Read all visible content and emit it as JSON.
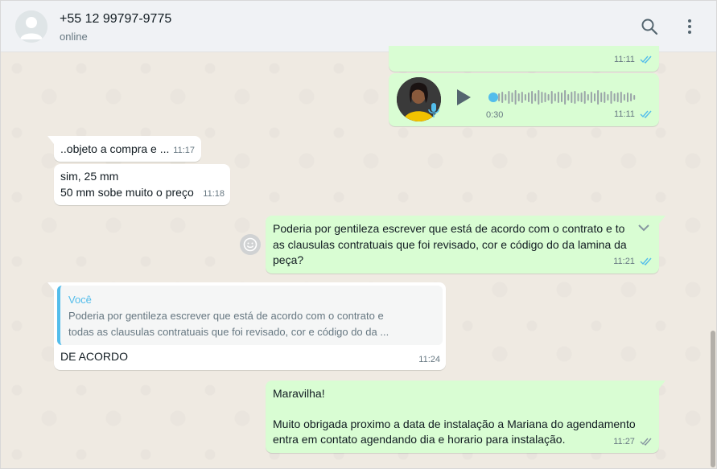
{
  "header": {
    "contact_name": "+55 12 99797-9775",
    "status": "online"
  },
  "messages": {
    "m1": {
      "time": "11:11"
    },
    "audio": {
      "duration": "0:30",
      "time": "11:11",
      "progress": 0.0
    },
    "m3": {
      "text": "..objeto a compra e ...",
      "time": "11:17"
    },
    "m4": {
      "line1": "sim, 25 mm",
      "line2": "50 mm sobe muito o preço",
      "time": "11:18"
    },
    "m5": {
      "line1": "Poderia por gentileza escrever que está de acordo com o contrato e to",
      "line2": "as clausulas contratuais que foi revisado, cor e código do da lamina da",
      "line3": "peça?",
      "time": "11:21"
    },
    "m6": {
      "quote_author": "Você",
      "quote_line1": "Poderia por gentileza escrever que está de acordo com o contrato e",
      "quote_line2": "todas as clausulas contratuais que foi revisado, cor e código do da ...",
      "text": "DE ACORDO",
      "time": "11:24"
    },
    "m7": {
      "line1": "Maravilha!",
      "line2": "Muito obrigada proximo a data de instalação a Mariana do agendamento",
      "line3": "entra em contato agendando dia e horario para instalação.",
      "time": "11:27"
    }
  },
  "colors": {
    "outgoing": "#d9fdd3",
    "incoming": "#ffffff",
    "read_ticks": "#53bdeb",
    "quote_accent": "#53bdeb"
  },
  "icons": {
    "search": "search-icon",
    "menu": "more-vertical-icon",
    "play": "play-icon",
    "mic": "mic-icon",
    "emoji": "emoji-icon",
    "chevron": "chevron-down-icon"
  }
}
